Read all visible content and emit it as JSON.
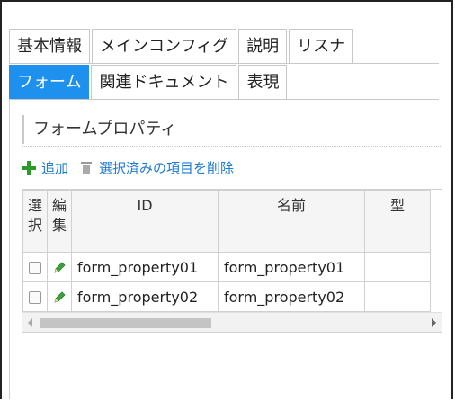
{
  "tabs_row1": [
    {
      "label": "基本情報"
    },
    {
      "label": "メインコンフィグ"
    },
    {
      "label": "説明"
    },
    {
      "label": "リスナ"
    }
  ],
  "tabs_row2": [
    {
      "label": "フォーム",
      "active": true
    },
    {
      "label": "関連ドキュメント"
    },
    {
      "label": "表現"
    }
  ],
  "section": {
    "title": "フォームプロパティ"
  },
  "actions": {
    "add": "追加",
    "delete": "選択済みの項目を削除"
  },
  "table": {
    "headers": {
      "select": "選\n択",
      "edit": "編\n集",
      "id": "ID",
      "name": "名前",
      "type": "型"
    },
    "rows": [
      {
        "id": "form_property01",
        "name": "form_property01",
        "type": ""
      },
      {
        "id": "form_property02",
        "name": "form_property02",
        "type": ""
      }
    ]
  },
  "colors": {
    "accent": "#1e90ee",
    "add_icon": "#2a9a2a",
    "link": "#1e7ad0"
  }
}
